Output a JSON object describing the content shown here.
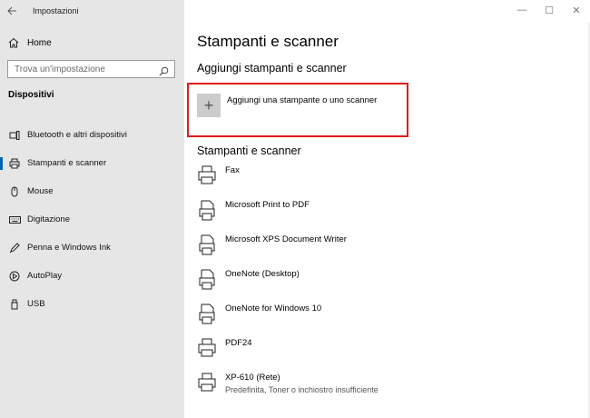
{
  "window": {
    "title": "Impostazioni",
    "controls": {
      "minimize": "—",
      "maximize": "☐",
      "close": "✕"
    }
  },
  "sidebar": {
    "home_label": "Home",
    "search_placeholder": "Trova un'impostazione",
    "section_label": "Dispositivi",
    "items": [
      {
        "label": "Bluetooth e altri dispositivi",
        "icon": "bluetooth-icon"
      },
      {
        "label": "Stampanti e scanner",
        "icon": "printer-icon",
        "active": true
      },
      {
        "label": "Mouse",
        "icon": "mouse-icon"
      },
      {
        "label": "Digitazione",
        "icon": "keyboard-icon"
      },
      {
        "label": "Penna e Windows Ink",
        "icon": "pen-icon"
      },
      {
        "label": "AutoPlay",
        "icon": "autoplay-icon"
      },
      {
        "label": "USB",
        "icon": "usb-icon"
      }
    ]
  },
  "main": {
    "title": "Stampanti e scanner",
    "add_heading": "Aggiungi stampanti e scanner",
    "add_button_label": "Aggiungi una stampante o uno scanner",
    "list_heading": "Stampanti e scanner",
    "printers": [
      {
        "name": "Fax",
        "status": "",
        "icon": "fax-printer-icon"
      },
      {
        "name": "Microsoft Print to PDF",
        "status": "",
        "icon": "document-printer-icon"
      },
      {
        "name": "Microsoft XPS Document Writer",
        "status": "",
        "icon": "document-printer-icon"
      },
      {
        "name": "OneNote (Desktop)",
        "status": "",
        "icon": "document-printer-icon"
      },
      {
        "name": "OneNote for Windows 10",
        "status": "",
        "icon": "document-printer-icon"
      },
      {
        "name": "PDF24",
        "status": "",
        "icon": "printer-icon"
      },
      {
        "name": "XP-610 (Rete)",
        "status": "Predefinita, Toner o inchiostro insufficiente",
        "icon": "printer-icon"
      }
    ]
  },
  "colors": {
    "sidebar_bg": "#e6e6e6",
    "accent": "#0063b1",
    "highlight_border": "#e21b1b"
  }
}
